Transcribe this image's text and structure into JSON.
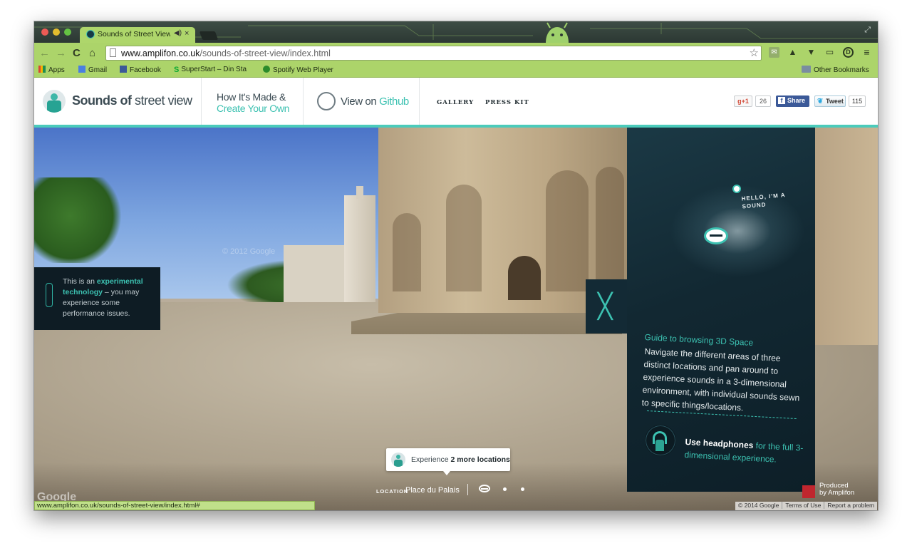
{
  "browser": {
    "tab_title": "Sounds of Street View b",
    "tab_speaker_icon": "speaker-icon",
    "tab_close": "×",
    "url_domain": "www.amplifon.co.uk",
    "url_path": "/sounds-of-street-view/index.html",
    "status_url": "www.amplifon.co.uk/sounds-of-street-view/index.html#"
  },
  "bookmarks": [
    {
      "label": "Apps",
      "icon": "apps-grid-icon"
    },
    {
      "label": "Gmail",
      "icon": "gmail-icon"
    },
    {
      "label": "Facebook",
      "icon": "facebook-icon"
    },
    {
      "label": "SuperStart – Din Sta",
      "icon": "superstart-icon"
    },
    {
      "label": "Spotify Web Player",
      "icon": "spotify-icon"
    },
    {
      "label": "Other Bookmarks",
      "icon": "folder-icon"
    }
  ],
  "header": {
    "logo_bold": "Sounds of",
    "logo_light": " street view",
    "howit_line1": "How It's Made &",
    "howit_line2": "Create Your Own",
    "github_a": "View on",
    "github_b": " Github",
    "nav": [
      "GALLERY",
      "PRESS KIT"
    ],
    "gplus_label": "g+1",
    "gplus_count": "26",
    "fb_label": "Share",
    "tweet_label": "Tweet",
    "tweet_count": "115"
  },
  "notice": {
    "pre": "This is an ",
    "highlight": "experimental technology",
    "post": " – you may experience some performance issues."
  },
  "guide": {
    "hello": "HELLO, I'M A SOUND",
    "title": "Guide to browsing 3D Space",
    "body": "Navigate the different areas of three distinct locations and pan around to experience sounds in a 3-dimensional environment, with individual sounds sewn to specific things/locations.",
    "hp_strong": "Use headphones",
    "hp_rest": " for the full 3-dimensional experience."
  },
  "experience": {
    "pre": "Experience ",
    "bold": "2 more locations"
  },
  "location": {
    "label": "LOCATION",
    "value": "Place du Palais"
  },
  "produced": {
    "line1": "Produced",
    "line2": "by Amplifon"
  },
  "footer": {
    "copyright": "© 2014 Google",
    "terms": "Terms of Use",
    "report": "Report a problem"
  },
  "scene": {
    "watermark": "© 2012 Google",
    "google": "Google"
  },
  "colors": {
    "accent": "#3cc1b1",
    "panel": "#122832",
    "chrome_green": "#acd46a"
  }
}
